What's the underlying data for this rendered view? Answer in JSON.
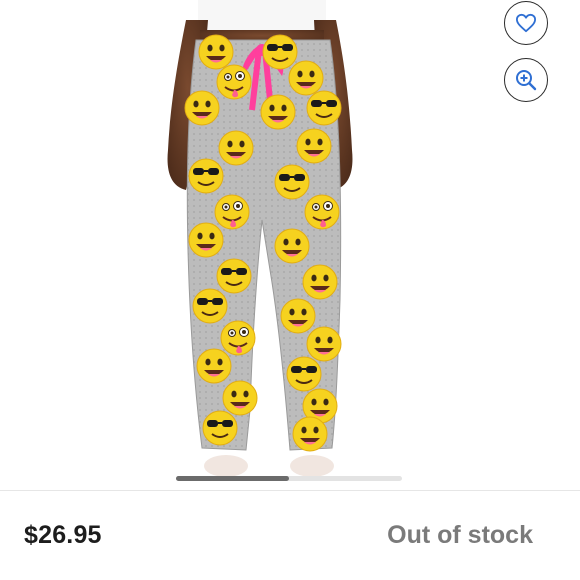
{
  "product": {
    "image_alt": "Women's emoji print fleece pajama pants",
    "price": "$26.95",
    "availability": "Out of stock"
  },
  "actions": {
    "favorite_icon": "heart-icon",
    "zoom_icon": "zoom-in-icon"
  },
  "gallery": {
    "current_index": 1,
    "image_count": 2
  },
  "colors": {
    "accent_blue": "#2f6fd3",
    "pants_gray": "#b8b8b8",
    "emoji_yellow": "#f6d21f",
    "ribbon_pink": "#ff3f9d",
    "stock_gray": "#7a7a7a"
  }
}
